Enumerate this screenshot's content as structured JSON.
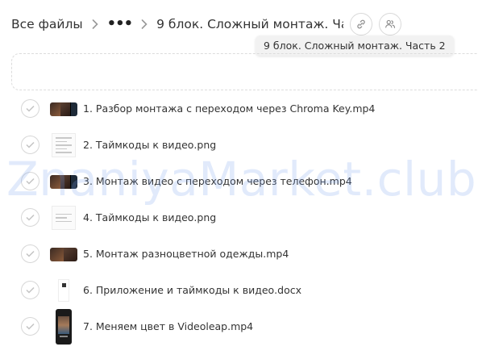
{
  "breadcrumb": {
    "root_label": "Все файлы",
    "ellipsis": "•••",
    "current_label": "9 блок. Сложный монтаж. Ча..."
  },
  "tooltip": {
    "text": "9 блок. Сложный монтаж. Часть 2"
  },
  "files": [
    {
      "name": "1. Разбор монтажа с переходом через Chroma Key.mp4",
      "thumb": "video-thumbnail"
    },
    {
      "name": "2. Таймкоды к видео.png",
      "thumb": "document-thumbnail"
    },
    {
      "name": "3. Монтаж видео с переходом через телефон.mp4",
      "thumb": "video-thumbnail"
    },
    {
      "name": "4. Таймкоды к видео.png",
      "thumb": "document-thumbnail"
    },
    {
      "name": "5. Монтаж разноцветной одежды.mp4",
      "thumb": "video-thumbnail"
    },
    {
      "name": "6. Приложение и таймкоды к видео.docx",
      "thumb": "docx-thumbnail"
    },
    {
      "name": "7. Меняем цвет в Videoleap.mp4",
      "thumb": "phone-video-thumbnail"
    }
  ],
  "watermark": {
    "text": "ZnaniyaMarket.club"
  },
  "icons": {
    "separator": "chevron-right-icon",
    "share_link": "link-icon",
    "members": "users-icon",
    "select": "checkmark-icon"
  },
  "colors": {
    "text": "#333333",
    "border": "#d9d9d9",
    "tooltip_bg": "#f2f2f2",
    "watermark": "#a9c3f0"
  }
}
